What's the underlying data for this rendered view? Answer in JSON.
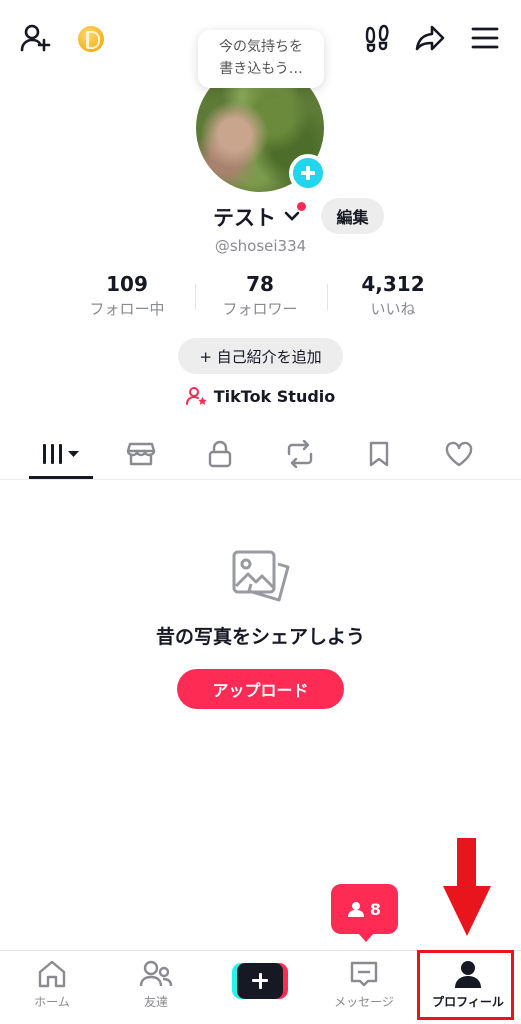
{
  "header": {
    "icons": [
      "add-friend-icon",
      "coin-icon",
      "footprints-icon",
      "share-icon",
      "menu-icon"
    ]
  },
  "bubble": {
    "line1": "今の気持ちを",
    "line2": "書き込もう…"
  },
  "profile": {
    "name": "テスト",
    "handle": "@shosei334",
    "edit_label": "編集",
    "stats": [
      {
        "value": "109",
        "label": "フォロー中"
      },
      {
        "value": "78",
        "label": "フォロワー"
      },
      {
        "value": "4,312",
        "label": "いいね"
      }
    ],
    "bio_button": "+ 自己紹介を追加",
    "studio_label": "TikTok Studio"
  },
  "tabs": [
    {
      "icon": "grid-icon",
      "active": true
    },
    {
      "icon": "shop-icon",
      "active": false
    },
    {
      "icon": "lock-icon",
      "active": false
    },
    {
      "icon": "repost-icon",
      "active": false
    },
    {
      "icon": "bookmark-icon",
      "active": false
    },
    {
      "icon": "heart-icon",
      "active": false
    }
  ],
  "empty_state": {
    "message": "昔の写真をシェアしよう",
    "upload_label": "アップロード"
  },
  "notification": {
    "count": "8"
  },
  "bottom_nav": {
    "home": "ホーム",
    "friends": "友達",
    "messages": "メッセージ",
    "profile": "プロフィール"
  },
  "colors": {
    "accent": "#fe2c55",
    "cyan": "#20d5ec",
    "annotation_red": "#e8161c"
  }
}
